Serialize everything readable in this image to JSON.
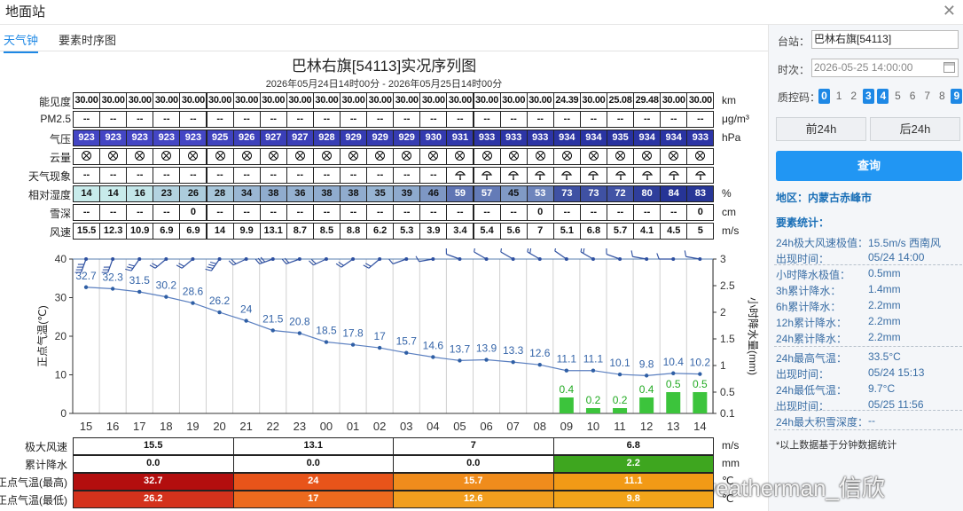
{
  "window": {
    "title": "地面站",
    "close_icon": "close-icon"
  },
  "tabs": [
    {
      "label": "天气钟"
    },
    {
      "label": "要素时序图"
    }
  ],
  "chart": {
    "title": "巴林右旗[54113]实况序列图",
    "subtitle": "2026年05月24日14时00分 - 2026年05月25日14时00分"
  },
  "row_labels": {
    "visibility": "能见度",
    "pm25": "PM2.5",
    "pressure": "气压",
    "cloud": "云量",
    "weather": "天气现象",
    "humidity": "相对湿度",
    "snow": "雪深",
    "wind": "风速"
  },
  "units": {
    "visibility": "km",
    "pm25": "μg/m³",
    "pressure": "hPa",
    "humidity": "%",
    "snow": "cm",
    "wind": "m/s"
  },
  "table": {
    "visibility": [
      "30.00",
      "30.00",
      "30.00",
      "30.00",
      "30.00",
      "30.00",
      "30.00",
      "30.00",
      "30.00",
      "30.00",
      "30.00",
      "30.00",
      "30.00",
      "30.00",
      "30.00",
      "30.00",
      "30.00",
      "30.00",
      "24.39",
      "30.00",
      "25.08",
      "29.48",
      "30.00",
      "30.00"
    ],
    "pm25": [
      "--",
      "--",
      "--",
      "--",
      "--",
      "--",
      "--",
      "--",
      "--",
      "--",
      "--",
      "--",
      "--",
      "--",
      "--",
      "--",
      "--",
      "--",
      "--",
      "--",
      "--",
      "--",
      "--",
      "--"
    ],
    "pressure": [
      "923",
      "923",
      "923",
      "923",
      "923",
      "925",
      "926",
      "927",
      "927",
      "928",
      "929",
      "929",
      "929",
      "930",
      "931",
      "933",
      "933",
      "933",
      "934",
      "934",
      "935",
      "934",
      "934",
      "933"
    ],
    "weather": [
      "--",
      "--",
      "--",
      "--",
      "--",
      "--",
      "--",
      "--",
      "--",
      "--",
      "--",
      "--",
      "--",
      "--",
      "rain",
      "rain",
      "rain",
      "rain",
      "rain",
      "rain",
      "rain",
      "rain",
      "rain",
      "rain"
    ],
    "humidity": [
      "14",
      "14",
      "16",
      "23",
      "26",
      "28",
      "34",
      "38",
      "36",
      "38",
      "38",
      "35",
      "39",
      "46",
      "59",
      "57",
      "45",
      "53",
      "73",
      "73",
      "72",
      "80",
      "84",
      "83"
    ],
    "snow": [
      "--",
      "--",
      "--",
      "--",
      "0",
      "--",
      "--",
      "--",
      "--",
      "--",
      "--",
      "--",
      "--",
      "--",
      "--",
      "--",
      "--",
      "0",
      "--",
      "--",
      "--",
      "--",
      "--",
      "0"
    ],
    "wind": [
      "15.5",
      "12.3",
      "10.9",
      "6.9",
      "6.9",
      "14",
      "9.9",
      "13.1",
      "8.7",
      "8.5",
      "8.8",
      "6.2",
      "5.3",
      "3.9",
      "3.4",
      "5.4",
      "5.6",
      "7",
      "5.1",
      "6.8",
      "5.7",
      "4.1",
      "4.5",
      "5"
    ]
  },
  "cloud_icon": "cloud-cover-icon",
  "rain_icon": "rain-icon",
  "chart_data": {
    "type": "line",
    "ylabel": "正点气温(℃)",
    "y2label": "小时降水量(mm)",
    "ylim": [
      0,
      40
    ],
    "y2lim": [
      0.1,
      3
    ],
    "yticks": [
      "0",
      "10",
      "20",
      "30",
      "40"
    ],
    "y2ticks": [
      "0.1",
      "0.5",
      "1",
      "1.5",
      "2",
      "2.5",
      "3"
    ],
    "categories": [
      "15",
      "16",
      "17",
      "18",
      "19",
      "20",
      "21",
      "22",
      "23",
      "00",
      "01",
      "02",
      "03",
      "04",
      "05",
      "06",
      "07",
      "08",
      "09",
      "10",
      "11",
      "12",
      "13",
      "14"
    ],
    "series": [
      {
        "values": [
          32.7,
          32.3,
          31.5,
          30.2,
          28.6,
          26.2,
          24,
          21.5,
          20.8,
          18.5,
          17.8,
          17,
          15.7,
          14.6,
          13.7,
          13.9,
          13.3,
          12.6,
          11.1,
          11.1,
          10.1,
          9.8,
          10.4,
          10.2
        ]
      },
      {
        "type": "bar",
        "values": [
          null,
          null,
          null,
          null,
          null,
          null,
          null,
          null,
          null,
          null,
          null,
          null,
          null,
          null,
          null,
          null,
          null,
          null,
          0.4,
          0.2,
          0.2,
          0.4,
          0.5,
          0.5
        ]
      }
    ],
    "wind_barbs": "wind-barb-icon"
  },
  "summary": {
    "labels": {
      "max_wind": "极大风速",
      "precip": "累计降水",
      "temp_max": "正点气温(最高)",
      "temp_min": "正点气温(最低)"
    },
    "units": {
      "max_wind": "m/s",
      "precip": "mm",
      "temp_max": "℃",
      "temp_min": "℃"
    },
    "max_wind": [
      "15.5",
      "13.1",
      "7",
      "6.8"
    ],
    "precip": [
      "0.0",
      "0.0",
      "0.0",
      "2.2"
    ],
    "temp_max": [
      "32.7",
      "24",
      "15.7",
      "11.1"
    ],
    "temp_min": [
      "26.2",
      "17",
      "12.6",
      "9.8"
    ],
    "colors": {
      "precip_highlight": "#3ea61f",
      "temp_max": [
        "#b30e0e",
        "#e8541a",
        "#f08c1c",
        "#f29a16"
      ],
      "temp_min": [
        "#d4321c",
        "#ec6a1e",
        "#f19e1e",
        "#f3a41a"
      ]
    }
  },
  "panel": {
    "station_label": "台站：",
    "station_value": "巴林右旗[54113]",
    "time_label": "时次：",
    "time_value": "2026-05-25 14:00:00",
    "qc_label": "质控码：",
    "qc_codes": [
      "0",
      "1",
      "2",
      "3",
      "4",
      "5",
      "6",
      "7",
      "8",
      "9"
    ],
    "prev_btn": "前24h",
    "next_btn": "后24h",
    "query_btn": "查询",
    "area": "地区：内蒙古赤峰市",
    "stats_title": "要素统计：",
    "stats": [
      {
        "k": "24h极大风速极值：",
        "v": "15.5m/s 西南风"
      },
      {
        "k": "出现时间：",
        "v": "05/24 14:00"
      },
      {
        "k": "小时降水极值：",
        "v": "0.5mm"
      },
      {
        "k": "3h累计降水：",
        "v": "1.4mm"
      },
      {
        "k": "6h累计降水：",
        "v": "2.2mm"
      },
      {
        "k": "12h累计降水：",
        "v": "2.2mm"
      },
      {
        "k": "24h累计降水：",
        "v": "2.2mm"
      },
      {
        "k": "24h最高气温：",
        "v": "33.5°C"
      },
      {
        "k": "出现时间：",
        "v": "05/24 15:13"
      },
      {
        "k": "24h最低气温：",
        "v": "9.7°C"
      },
      {
        "k": "出现时间：",
        "v": "05/25 11:56"
      },
      {
        "k": "24h最大积雪深度：",
        "v": "--"
      }
    ],
    "note": "*以上数据基于分钟数据统计"
  },
  "watermark": "@weatherman_信欣"
}
